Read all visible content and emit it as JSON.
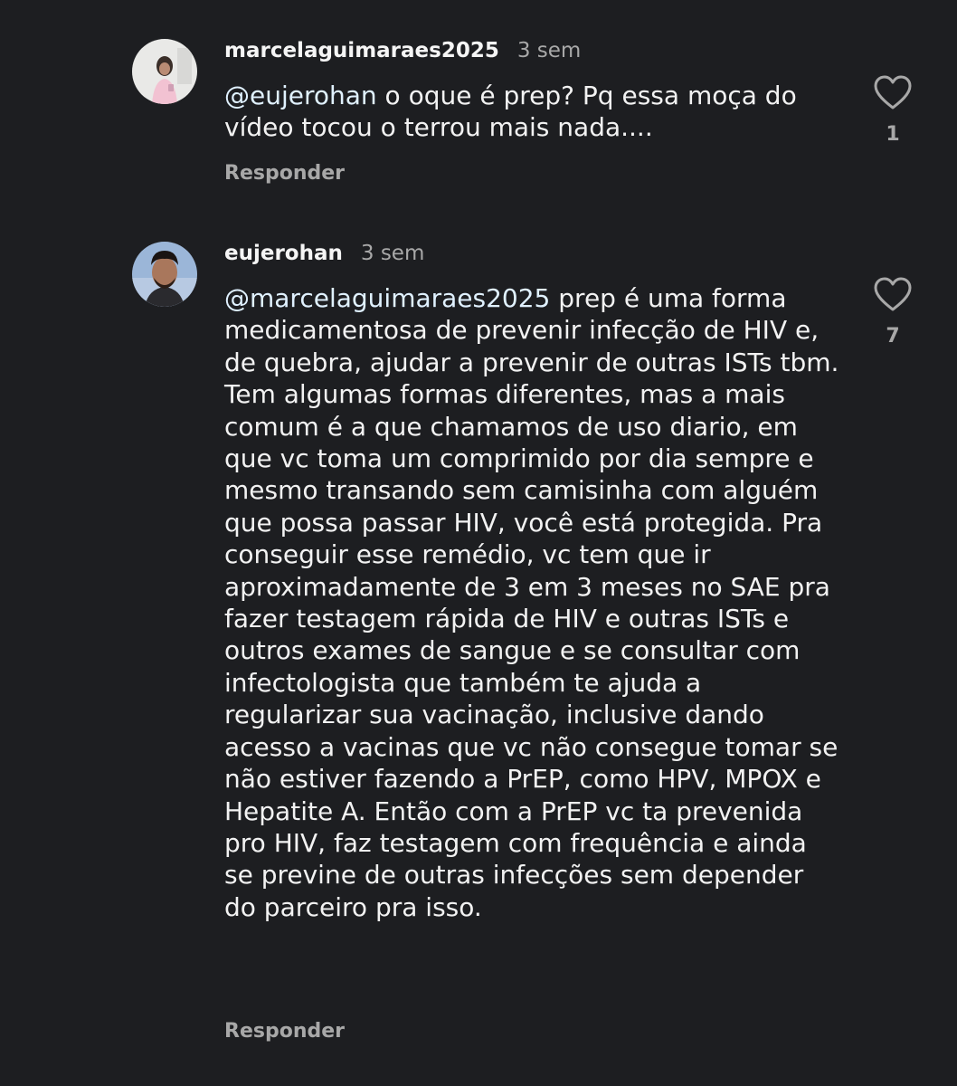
{
  "comments": [
    {
      "username": "marcelaguimaraes2025",
      "time": "3 sem",
      "mention": "@eujerohan",
      "text": " o oque é prep? Pq essa moça do vídeo tocou o terrou mais nada....",
      "likes": "1",
      "reply_label": "Responder",
      "avatar_icon": "profile-photo"
    },
    {
      "username": "eujerohan",
      "time": "3 sem",
      "mention": "@marcelaguimaraes2025",
      "text": " prep é uma forma medicamentosa de prevenir infecção de HIV e, de quebra, ajudar a prevenir de outras ISTs tbm. Tem algumas formas diferentes, mas a mais comum é a que chamamos de uso diario, em que vc toma um comprimido por dia sempre e mesmo transando sem camisinha com alguém que possa passar HIV, você está protegida. Pra conseguir esse remédio, vc tem que ir aproximadamente de 3 em 3 meses no SAE pra fazer testagem rápida de HIV e outras ISTs e outros exames de sangue e se consultar com infectologista que também te ajuda a regularizar sua vacinação, inclusive dando acesso a vacinas que vc não consegue tomar se não estiver fazendo a PrEP, como HPV, MPOX e Hepatite A. Então com a PrEP vc ta prevenida pro HIV, faz testagem com frequência e ainda se previne de outras infecções sem depender do parceiro pra isso.",
      "likes": "7",
      "reply_label": "Responder",
      "avatar_icon": "profile-photo"
    }
  ],
  "theme": {
    "background": "#1d1e21",
    "text": "#f2f2f2",
    "muted": "#a8a8a8",
    "mention": "#e0f1ff"
  },
  "icons": {
    "like": "heart-outline-icon"
  }
}
